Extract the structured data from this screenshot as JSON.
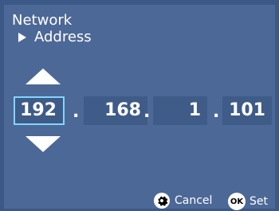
{
  "header": {
    "title": "Network",
    "subtitle": "Address"
  },
  "ip": {
    "octets": [
      "192",
      "168",
      "1",
      "101"
    ],
    "separator": ".",
    "selected_index": 0
  },
  "footer": {
    "cancel_label": "Cancel",
    "ok_badge": "OK",
    "set_label": "Set"
  },
  "colors": {
    "background": "#3c5887",
    "panel": "#4c6896",
    "field": "#3f5b87",
    "selection": "#7fd6ff"
  },
  "icons": {
    "increment": "triangle-up-icon",
    "decrement": "triangle-down-icon",
    "cancel": "gear-icon",
    "set": "ok-button-icon"
  }
}
